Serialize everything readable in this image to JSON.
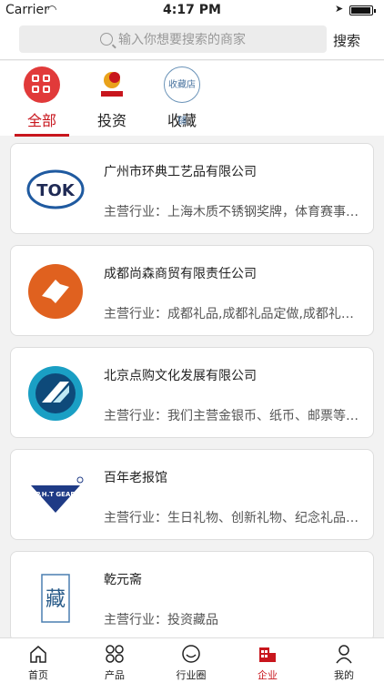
{
  "status": {
    "carrier": "Carrier",
    "time": "4:17 PM"
  },
  "search": {
    "placeholder": "输入你想要搜索的商家",
    "button": "搜索"
  },
  "tabs": [
    {
      "label": "全部",
      "icon": "grid-icon",
      "active": true
    },
    {
      "label": "投资",
      "icon": "invest-logo-icon",
      "active": false
    },
    {
      "label": "收藏",
      "icon": "collect-stamp-icon",
      "active": false,
      "stamp_text": "收藏店铺"
    }
  ],
  "companies": [
    {
      "name": "广州市环典工艺品有限公司",
      "business": "主营行业：上海木质不锈钢奖牌，体育赛事奖牌",
      "logo_text": "TOK"
    },
    {
      "name": "成都尚森商贸有限责任公司",
      "business": "主营行业：成都礼品,成都礼品定做,成都礼品公司",
      "logo_text": ""
    },
    {
      "name": "北京点购文化发展有限公司",
      "business": "主营行业：我们主营金银币、纸币、邮票等收藏品",
      "logo_text": ""
    },
    {
      "name": "百年老报馆",
      "business": "主营行业：生日礼物、创新礼物、纪念礼品定制",
      "logo_text": "P.H.T GEAR"
    },
    {
      "name": "乾元斋",
      "business": "主营行业：投资藏品",
      "logo_text": "藏"
    }
  ],
  "tabbar": [
    {
      "label": "首页",
      "icon": "home-icon",
      "active": false
    },
    {
      "label": "产品",
      "icon": "products-icon",
      "active": false
    },
    {
      "label": "行业圈",
      "icon": "circle-icon",
      "active": false
    },
    {
      "label": "企业",
      "icon": "enterprise-icon",
      "active": true
    },
    {
      "label": "我的",
      "icon": "profile-icon",
      "active": false
    }
  ],
  "colors": {
    "accent": "#c8161d"
  }
}
